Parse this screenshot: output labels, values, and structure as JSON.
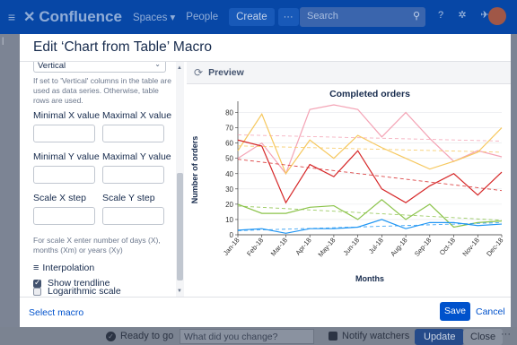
{
  "nav": {
    "logo": "Confluence",
    "spaces": "Spaces ▾",
    "people": "People",
    "create": "Create",
    "more": "···",
    "search_placeholder": "Search"
  },
  "dialog": {
    "title": "Edit ‘Chart from Table’ Macro",
    "left": {
      "series_select_value": "Vertical",
      "series_help": "If set to 'Vertical' columns in the table are used as data series. Otherwise, table rows are used.",
      "min_x_label": "Minimal X value",
      "max_x_label": "Maximal X value",
      "min_y_label": "Minimal Y value",
      "max_y_label": "Maximal Y value",
      "scale_x_label": "Scale X step",
      "scale_y_label": "Scale Y step",
      "scale_help": "For scale X enter number of days (X), months (Xm) or years (Xy)",
      "interpolation_label": "Interpolation",
      "log_scale_label": "Logarithmic scale",
      "log_scale_checked": false,
      "trendline_label": "Show trendline",
      "trendline_checked": true
    },
    "preview_label": "Preview",
    "footer": {
      "select_macro": "Select macro",
      "save": "Save",
      "cancel": "Cancel"
    }
  },
  "bottom_bar": {
    "ready": "Ready to go",
    "change_placeholder": "What did you change?",
    "notify": "Notify watchers",
    "update": "Update",
    "close": "Close",
    "more": "···"
  },
  "chart_data": {
    "type": "line",
    "title": "Completed orders",
    "xlabel": "Months",
    "ylabel": "Number of orders",
    "ylim": [
      0,
      85
    ],
    "yticks": [
      0,
      10,
      20,
      30,
      40,
      50,
      60,
      70,
      80
    ],
    "categories": [
      "Jan-18",
      "Feb-18",
      "Mar-18",
      "Apr-18",
      "May-18",
      "Jun-18",
      "Jul-18",
      "Aug-18",
      "Sep-18",
      "Oct-18",
      "Nov-18",
      "Dec-18"
    ],
    "trendline": true,
    "series": [
      {
        "color": "#f4a3b5",
        "values": [
          50,
          60,
          40,
          82,
          85,
          82,
          64,
          80,
          63,
          48,
          55,
          51
        ]
      },
      {
        "color": "#f6c85f",
        "values": [
          55,
          79,
          40,
          62,
          50,
          65,
          57,
          50,
          43,
          48,
          54,
          70
        ]
      },
      {
        "color": "#d62728",
        "values": [
          62,
          58,
          21,
          46,
          38,
          55,
          30,
          21,
          32,
          40,
          26,
          41
        ]
      },
      {
        "color": "#8bc34a",
        "values": [
          20,
          14,
          14,
          18,
          19,
          10,
          23,
          10,
          20,
          5,
          8,
          9
        ]
      },
      {
        "color": "#2196f3",
        "values": [
          3,
          4,
          1,
          4,
          4,
          5,
          10,
          4,
          8,
          8,
          6,
          7
        ]
      }
    ]
  }
}
